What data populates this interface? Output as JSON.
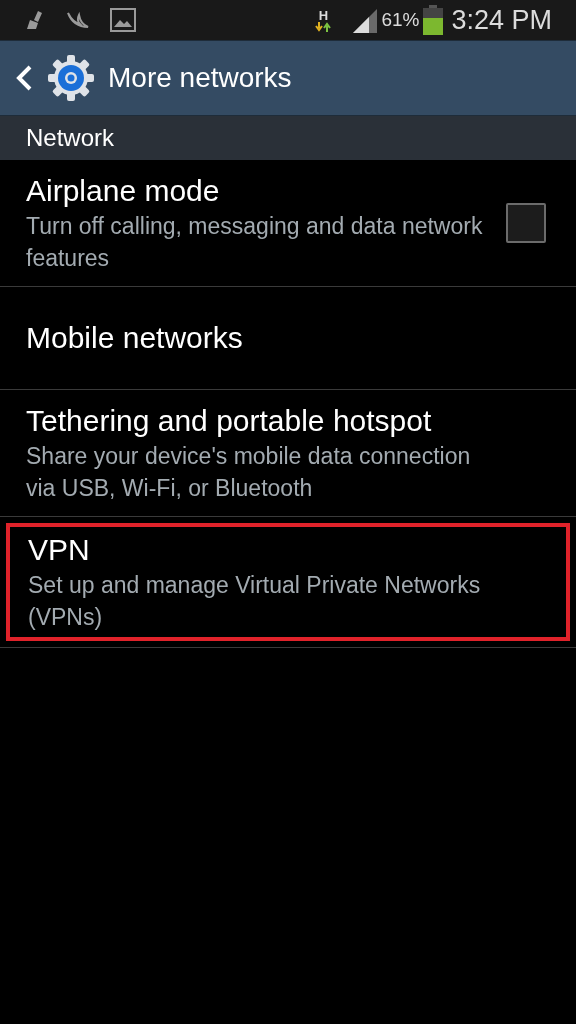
{
  "status_bar": {
    "network_type": "H",
    "battery": "61%",
    "time": "3:24 PM"
  },
  "header": {
    "title": "More networks"
  },
  "section": {
    "title": "Network"
  },
  "items": [
    {
      "kind": "checkbox",
      "title": "Airplane mode",
      "subtitle": "Turn off calling, messaging and data network features",
      "checked": false,
      "highlighted": false
    },
    {
      "kind": "plain",
      "title": "Mobile networks",
      "highlighted": false
    },
    {
      "kind": "plain",
      "title": "Tethering and portable hotspot",
      "subtitle": "Share your device's mobile data connection via USB, Wi-Fi, or Bluetooth",
      "highlighted": false
    },
    {
      "kind": "plain",
      "title": "VPN",
      "subtitle": "Set up and manage Virtual Private Networks (VPNs)",
      "highlighted": true
    }
  ]
}
